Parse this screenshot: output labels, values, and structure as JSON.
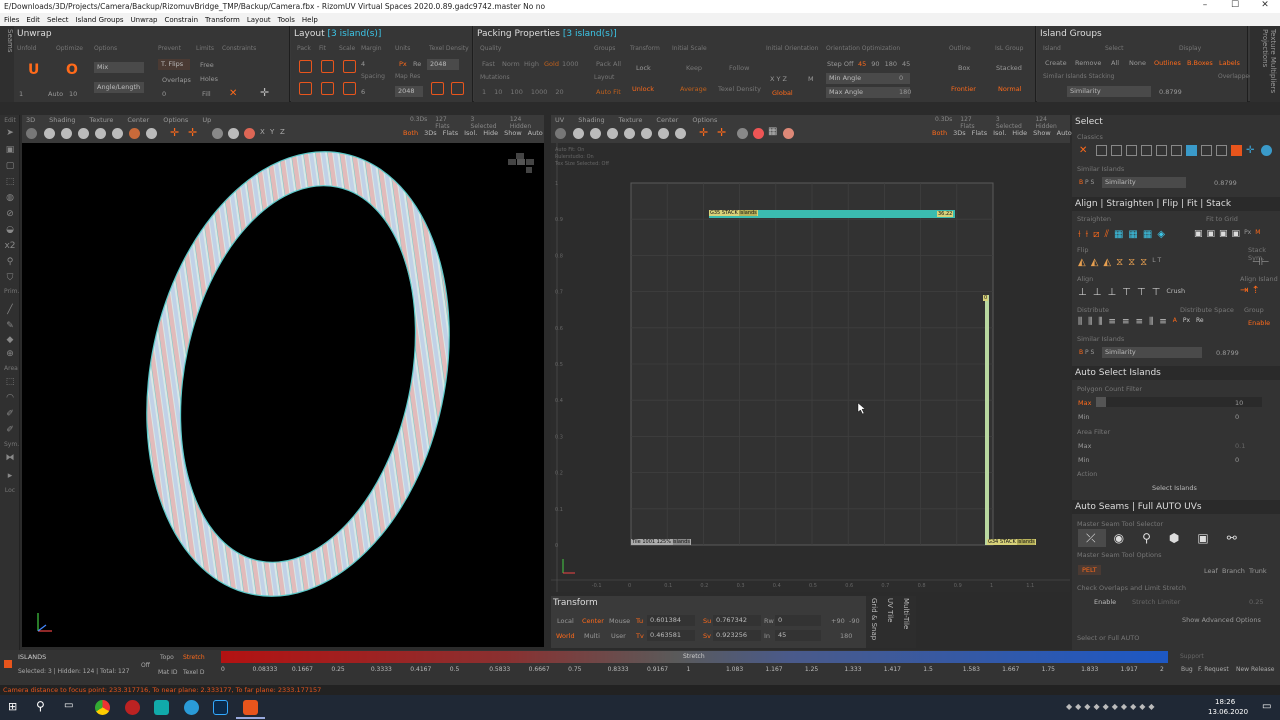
{
  "window": {
    "title": "E/Downloads/3D/Projects/Camera/Backup/RizomuvBridge_TMP/Backup/Camera.fbx - RizomUV  Virtual Spaces 2020.0.89.gadc9742.master No no",
    "min": "–",
    "max": "☐",
    "close": "✕"
  },
  "menu": [
    "Files",
    "Edit",
    "Select",
    "Island Groups",
    "Unwrap",
    "Constrain",
    "Transform",
    "Layout",
    "Tools",
    "Help"
  ],
  "seams_tab": "Seams",
  "unwrap": {
    "title": "Unwrap",
    "unfold": "Unfold",
    "optimize": "Optimize",
    "options": "Options",
    "mix": "Mix",
    "angle_length": "Angle/Length",
    "prevent": "Prevent",
    "t_flips": "T. Flips",
    "overlaps": "Overlaps",
    "limits": "Limits",
    "free": "Free",
    "holes": "Holes",
    "fill": "Fill",
    "constraints": "Constraints",
    "auto": "Auto",
    "val1": "1",
    "val10": "10",
    "val0": "0"
  },
  "layout": {
    "title": "Layout",
    "sel": "[3 island(s)]",
    "pack": "Pack",
    "fit": "Fit",
    "scale": "Scale",
    "margin": "Margin",
    "margin_val": "4",
    "spacing": "Spacing",
    "spacing_val": "6",
    "units": "Units",
    "px": "Px",
    "re": "Re",
    "texel_density": "Texel Density",
    "td_val": "2048",
    "map_res": "Map Res",
    "map_res_val": "2048"
  },
  "packing": {
    "title": "Packing Properties",
    "sel": "[3 island(s)]",
    "quality": "Quality",
    "fast": "Fast",
    "norm": "Norm",
    "high": "High",
    "gold": "Gold",
    "gold_val": "1000",
    "mutations": "Mutations",
    "mut_vals": [
      "1",
      "10",
      "100",
      "1000",
      "20"
    ],
    "groups": "Groups",
    "pack_all": "Pack All",
    "layout": "Layout",
    "auto_fit": "Auto Fit",
    "transform": "Transform",
    "lock": "Lock",
    "unlock": "Unlock",
    "initial_scale": "Initial Scale",
    "keep": "Keep",
    "follow": "Follow",
    "average": "Average",
    "texel_density": "Texel Density",
    "initial_orientation": "Initial Orientation",
    "xyz": "X  Y  Z",
    "m": "M",
    "global": "Global",
    "orientation_optimization": "Orientation Optimization",
    "step_off": "Step Off",
    "steps": [
      "45",
      "90",
      "180",
      "45"
    ],
    "min_angle": "Min Angle",
    "min_angle_val": "0",
    "max_angle": "Max Angle",
    "max_angle_val": "180",
    "outline": "Outline",
    "box": "Box",
    "frontier": "Frontier",
    "isl_group": "IsL Group",
    "stacked": "Stacked",
    "normal": "Normal"
  },
  "island_groups": {
    "title": "Island Groups",
    "island": "Island",
    "select": "Select",
    "display": "Display",
    "create": "Create",
    "remove": "Remove",
    "all": "All",
    "none": "None",
    "outlines": "Outlines",
    "bboxes": "B.Boxes",
    "labels": "Labels",
    "similar_stacking": "Similar Islands Stacking",
    "overlapped": "Overlapped",
    "similarity": "Similarity",
    "similarity_val": "0.8799"
  },
  "right_tabs": "Texture Multipliers  Projections",
  "vp3d": {
    "tabs": [
      "3D",
      "Shading",
      "Texture",
      "Center",
      "Options",
      "Up"
    ],
    "modes": [
      "Both",
      "3Ds",
      "Flats",
      "Isol.",
      "Hide",
      "Show",
      "Auto"
    ],
    "info": [
      "0.3Ds",
      "127 Flats",
      "3 Selected",
      "124 Hidden"
    ]
  },
  "uv": {
    "tabs": [
      "UV",
      "Shading",
      "Texture",
      "Center",
      "Options"
    ],
    "modes": [
      "Both",
      "3Ds",
      "Flats",
      "Isol.",
      "Hide",
      "Show",
      "Auto"
    ],
    "info": [
      "0.3Ds",
      "127 Flats",
      "3 Selected",
      "124 Hidden"
    ],
    "hud": [
      "Auto Fit: On",
      "Rulerstudio: On",
      "Tex Size Selected: Off"
    ],
    "label_top": "G35 STACK",
    "label_top_islands": "islands",
    "label_top_val": "36.22",
    "label_small": "0",
    "label_bottom_left": "Tile 1001 125%",
    "label_bottom_left_islands": "islands",
    "label_bottom_right": "G34 STACK",
    "label_bottom_right_islands": "islands",
    "y_ticks": [
      "1",
      "0.9",
      "0.8",
      "0.7",
      "0.6",
      "0.5",
      "0.4",
      "0.3",
      "0.2",
      "0.1",
      "0"
    ],
    "x_ticks": [
      "-0.1",
      "0",
      "0.1",
      "0.2",
      "0.3",
      "0.4",
      "0.5",
      "0.6",
      "0.7",
      "0.8",
      "0.9",
      "1",
      "1.1"
    ]
  },
  "transform": {
    "title": "Transform",
    "local": "Local",
    "center": "Center",
    "mouse": "Mouse",
    "world": "World",
    "multi": "Multi",
    "user": "User",
    "tu": "Tu",
    "tu_val": "0.601384",
    "tv": "Tv",
    "tv_val": "0.463581",
    "su": "Su",
    "su_val": "0.767342",
    "sv": "Sv",
    "sv_val": "0.923256",
    "rw": "Rw",
    "rw_val": "0",
    "in": "In",
    "in_val": "45",
    "p90": "+90",
    "m90": "-90",
    "r180": "180"
  },
  "vtabs": [
    "Grid & Snap",
    "UV Tile",
    "Multi-Tile"
  ],
  "select_panel": {
    "title": "Select",
    "classics": "Classics",
    "similar": "Similar Islands",
    "similarity": "Similarity",
    "similarity_val": "0.8799"
  },
  "align_panel": {
    "title": "Align | Straighten | Flip | Fit | Stack",
    "straighten": "Straighten",
    "fit_to_grid": "Fit to Grid",
    "flip": "Flip",
    "stack_sym": "Stack Sym.",
    "lt": "L  T",
    "align": "Align",
    "align_island": "Align Island",
    "crush": "Crush",
    "distribute": "Distribute",
    "distribute_space": "Distribute Space",
    "group": "Group",
    "a": "A",
    "px": "Px",
    "re": "Re",
    "enable": "Enable",
    "similar": "Similar Islands",
    "similarity": "Similarity",
    "similarity_val": "0.8799",
    "px2": "Px",
    "m": "M"
  },
  "auto_select": {
    "title": "Auto Select Islands",
    "poly_filter": "Polygon Count Filter",
    "max": "Max",
    "max_val": "10",
    "min": "Min",
    "min_val": "0",
    "area_filter": "Area Filter",
    "amax": "Max",
    "amax_val": "0.1",
    "amin": "Min",
    "amin_val": "0",
    "action": "Action",
    "select_islands": "Select Islands"
  },
  "auto_seams": {
    "title": "Auto Seams | Full AUTO UVs",
    "master": "Master Seam Tool Selector",
    "master_opts": "Master Seam Tool Options",
    "pelt": "PELT",
    "leaf": "Leaf",
    "branch": "Branch",
    "trunk": "Trunk",
    "check": "Check Overlaps and Limit Stretch",
    "enable": "Enable",
    "stretch_limiter": "Stretch Limiter",
    "stretch_val": "0.25",
    "show_adv": "Show Advanced Options",
    "select_full": "Select or Full AUTO"
  },
  "bottom": {
    "islands": "ISLANDS",
    "stats": "Selected: 3 | Hidden: 124 | Total: 127",
    "off": "Off",
    "topo": "Topo",
    "stretch": "Stretch",
    "mat_id": "Mat ID",
    "texel_d": "Texel D",
    "gradient_label": "Stretch",
    "scale": [
      "0",
      "0.08333",
      "0.1667",
      "0.25",
      "0.3333",
      "0.4167",
      "0.5",
      "0.5833",
      "0.6667",
      "0.75",
      "0.8333",
      "0.9167",
      "1",
      "1.083",
      "1.167",
      "1.25",
      "1.333",
      "1.417",
      "1.5",
      "1.583",
      "1.667",
      "1.75",
      "1.833",
      "1.917",
      "2"
    ],
    "support": "Support",
    "bug": "Bug",
    "request": "F. Request",
    "release": "New Release"
  },
  "status": "Camera distance to focus point: 233.317716, To near plane: 2.333177, To far plane: 2333.177157",
  "taskbar": {
    "time": "18:26",
    "date": "13.06.2020"
  },
  "left_tools": [
    "Edit",
    "Area",
    "Sym.",
    "Prim.",
    "Loc"
  ]
}
